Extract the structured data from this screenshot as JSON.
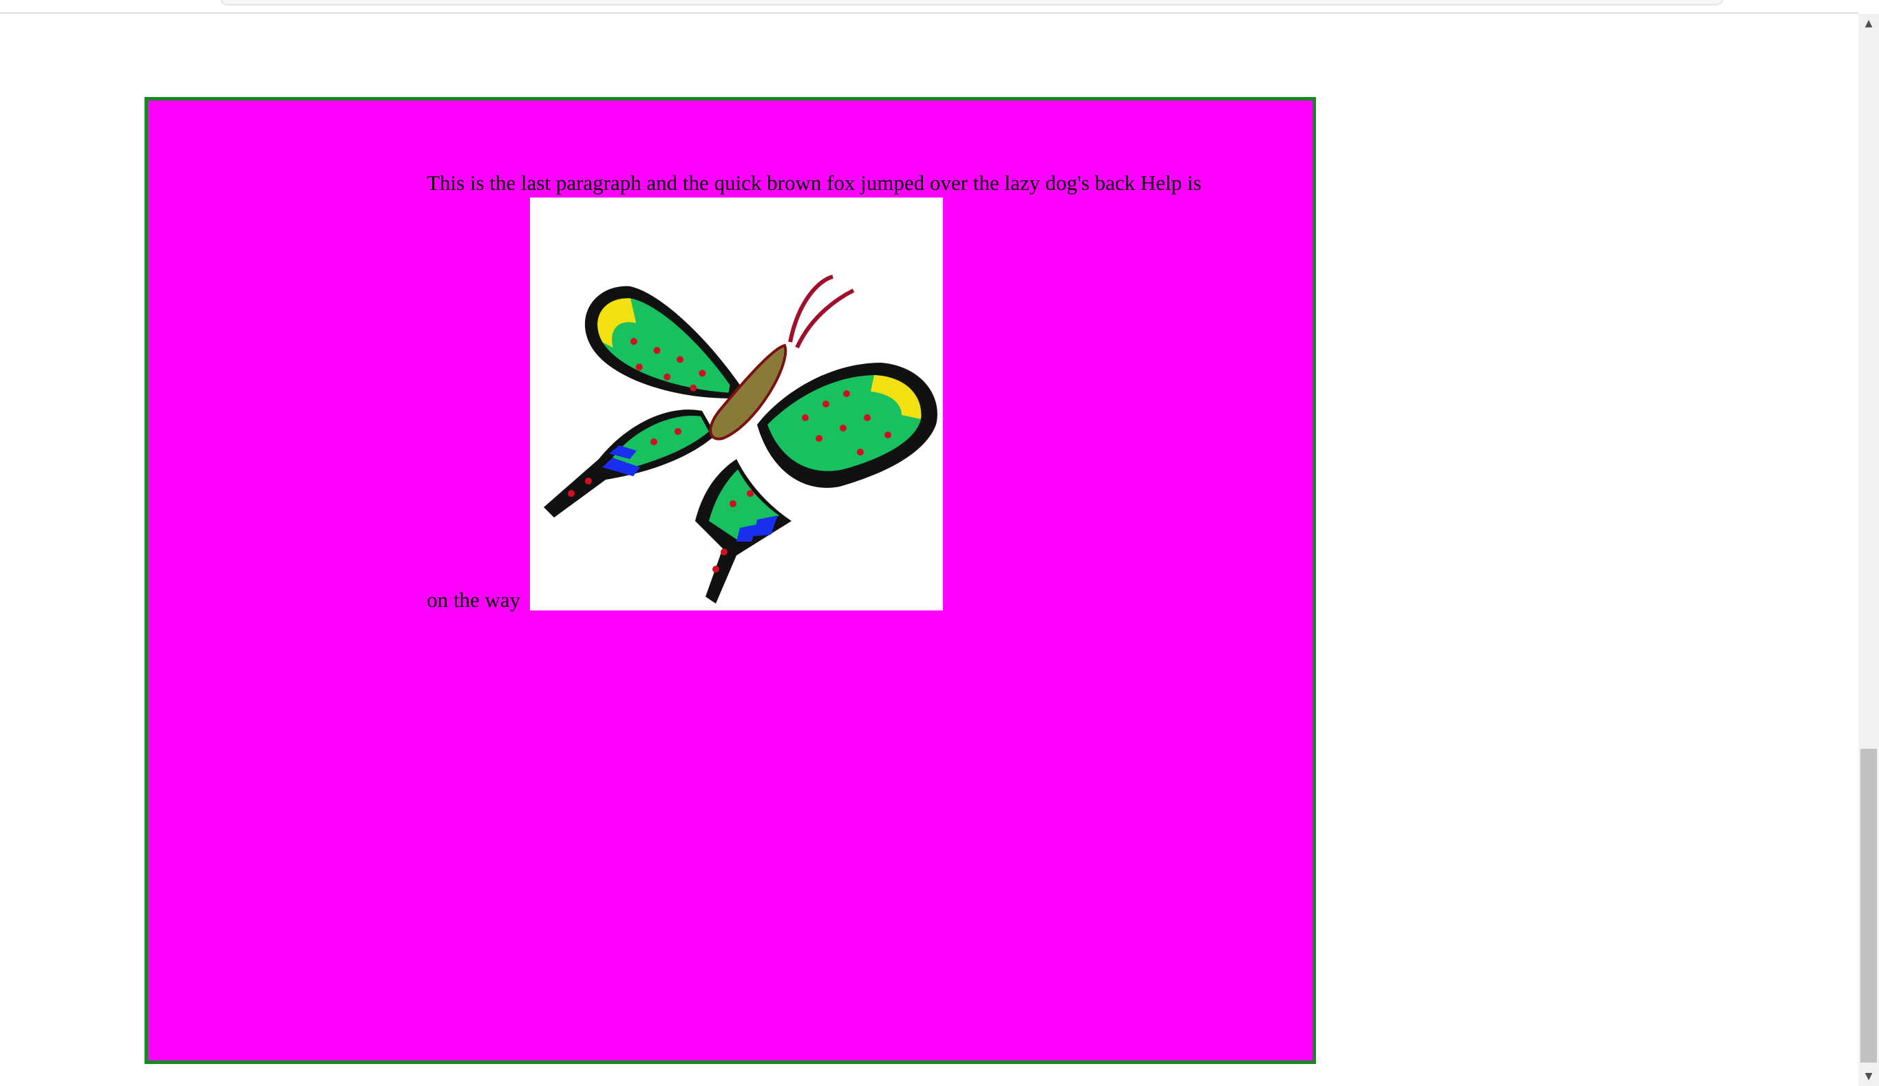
{
  "paragraph": {
    "line1": "This is the last paragraph and the quick brown fox jumped over the lazy dog's back Help is",
    "line2": "on the way"
  },
  "image": {
    "icon": "butterfly-icon",
    "background": "#ffffff"
  },
  "box": {
    "background": "#ff00ff",
    "border_color": "#138a1e"
  },
  "scrollbar": {
    "up_glyph": "▲",
    "down_glyph": "▼"
  }
}
